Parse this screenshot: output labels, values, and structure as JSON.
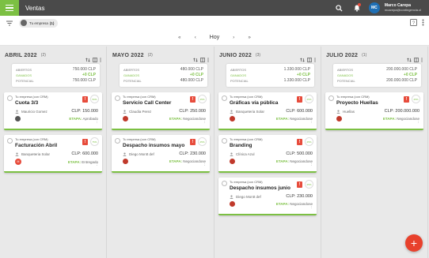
{
  "app": {
    "title": "Ventas"
  },
  "user": {
    "initials": "MC",
    "name": "Marco Carepa",
    "email": "mcarepa@contingencia.cl"
  },
  "filter": {
    "chip_label": "Tu empresa",
    "chip_count": "(1)"
  },
  "datenav": {
    "first": "«",
    "prev": "‹",
    "today": "Hoy",
    "next": "›",
    "last": "»"
  },
  "columns": [
    {
      "title": "ABRIL 2022",
      "count": "(2)",
      "summary": {
        "abiertos_label": "ABIERTOS",
        "abiertos": "750.000 CLP",
        "ganados_label": "GANADOS",
        "ganados": "+0 CLP",
        "potencial_label": "POTENCIAL",
        "potencial": "750.000 CLP"
      },
      "cards": [
        {
          "company": "Tu empresa (con CRM)",
          "title": "Cuota 3/3",
          "client": "Mauricio Gomez",
          "clp": "CLP: 150.000",
          "stage_label": "ETAPA:",
          "stage": "Aprobado",
          "pct": "50%"
        },
        {
          "company": "Tu empresa (con CRM)",
          "title": "Facturación Abril",
          "client": "Banqueteria Solar",
          "clp": "CLP: 600.000",
          "stage_label": "ETAPA:",
          "stage": "Entregado",
          "pct": "75%"
        }
      ]
    },
    {
      "title": "MAYO 2022",
      "count": "(2)",
      "summary": {
        "abiertos_label": "ABIERTOS",
        "abiertos": "480.000 CLP",
        "ganados_label": "GANADOS",
        "ganados": "+0 CLP",
        "potencial_label": "POTENCIAL",
        "potencial": "480.000 CLP"
      },
      "cards": [
        {
          "company": "Tu empresa (con CRM)",
          "title": "Servicio Call Center",
          "client": "Claudia Perez",
          "clp": "CLP: 250.000",
          "stage_label": "ETAPA:",
          "stage": "Negociandose",
          "pct": "25%"
        },
        {
          "company": "Tu empresa (con CRM)",
          "title": "Despacho insumos mayo",
          "client": "Diego Montt def",
          "clp": "CLP: 230.000",
          "stage_label": "ETAPA:",
          "stage": "Negociandose",
          "pct": "25%"
        }
      ]
    },
    {
      "title": "JUNIO 2022",
      "count": "(3)",
      "summary": {
        "abiertos_label": "ABIERTOS",
        "abiertos": "1.330.000 CLP",
        "ganados_label": "GANADOS",
        "ganados": "+0 CLP",
        "potencial_label": "POTENCIAL",
        "potencial": "1.330.000 CLP"
      },
      "cards": [
        {
          "company": "Tu empresa (con CRM)",
          "title": "Gráficas vía pública",
          "client": "Banqueteria Solar",
          "clp": "CLP: 600.000",
          "stage_label": "ETAPA:",
          "stage": "Negociandose",
          "pct": "25%"
        },
        {
          "company": "Tu empresa (con CRM)",
          "title": "Branding",
          "client": "Clínica Azul",
          "clp": "CLP: 500.000",
          "stage_label": "ETAPA:",
          "stage": "Negociandose",
          "pct": "25%"
        },
        {
          "company": "Tu empresa (con CRM)",
          "title": "Despacho insumos junio",
          "client": "Diego Montt def",
          "clp": "CLP: 230.000",
          "stage_label": "ETAPA:",
          "stage": "Negociandose",
          "pct": "25%"
        }
      ]
    },
    {
      "title": "JULIO 2022",
      "count": "(1)",
      "summary": {
        "abiertos_label": "ABIERTOS",
        "abiertos": "200.000.000 CLP",
        "ganados_label": "GANADOS",
        "ganados": "+0 CLP",
        "potencial_label": "POTENCIAL",
        "potencial": "200.000.000 CLP"
      },
      "cards": [
        {
          "company": "Tu empresa (con CRM)",
          "title": "Proyecto Huellas",
          "client": "Huellas",
          "clp": "CLP: 200.000.000",
          "stage_label": "ETAPA:",
          "stage": "Negociandose",
          "pct": "25%"
        }
      ]
    }
  ],
  "fab": {
    "label": "+"
  },
  "colors": {
    "green": "#7cc043",
    "topbar": "#4a4a4a",
    "fab": "#e8412c",
    "flag": "#e74c3c"
  },
  "icons": [
    "menu-icon",
    "search-icon",
    "bell-icon",
    "more-vert-icon",
    "filter-icon",
    "sort-icon",
    "column-toggle-icon",
    "flag-icon",
    "person-icon",
    "plus-icon"
  ]
}
